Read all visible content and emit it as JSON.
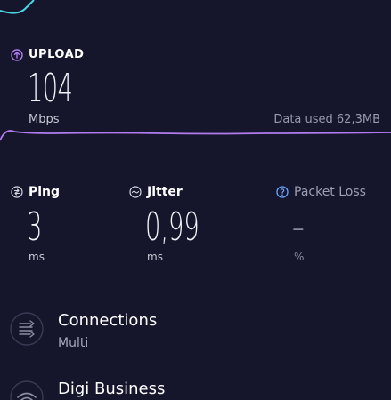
{
  "upload": {
    "label": "UPLOAD",
    "value": "104",
    "unit": "Mbps",
    "data_used": "Data used 62,3MB"
  },
  "metrics": {
    "ping": {
      "label": "Ping",
      "value": "3",
      "unit": "ms"
    },
    "jitter": {
      "label": "Jitter",
      "value": "0,99",
      "unit": "ms"
    },
    "packet_loss": {
      "label": "Packet Loss",
      "value": "–",
      "unit": "%"
    }
  },
  "connections": {
    "title": "Connections",
    "value": "Multi"
  },
  "provider": {
    "title": "Digi Business"
  },
  "colors": {
    "background": "#15152b",
    "upload_accent": "#b07cf0",
    "download_accent": "#49d6e6",
    "packet_loss_accent": "#6aa6ff"
  }
}
